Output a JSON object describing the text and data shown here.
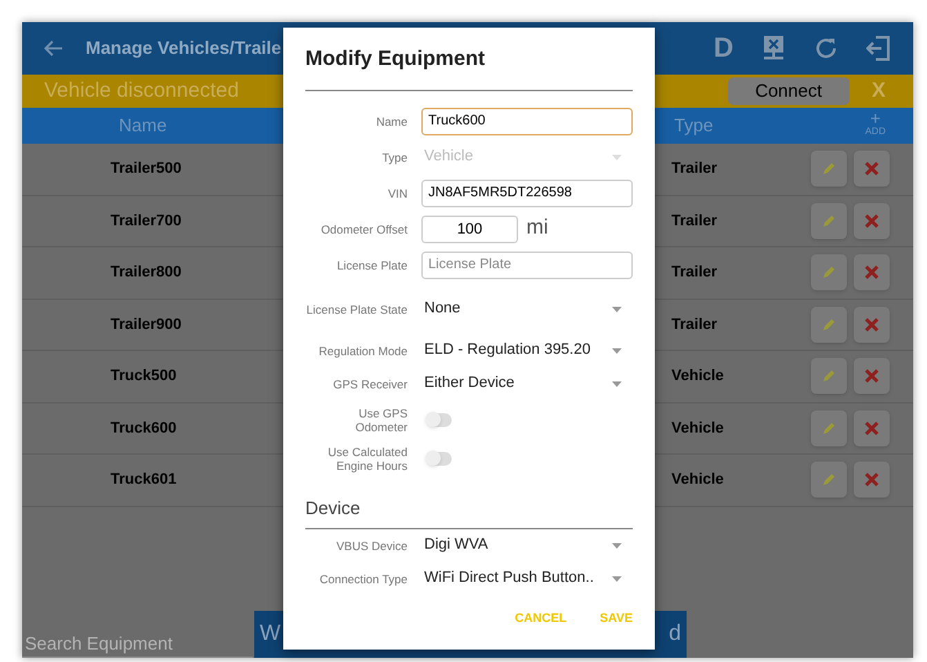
{
  "app_bar": {
    "title": "Manage Vehicles/Traile",
    "actions": [
      "D"
    ]
  },
  "banner": {
    "message": "Vehicle disconnected",
    "connect": "Connect",
    "dismiss": "X"
  },
  "table": {
    "columns": [
      "Name",
      "Type"
    ],
    "add": {
      "icon": "+",
      "label": "ADD"
    },
    "rows": [
      {
        "name": "Trailer500",
        "type": "Trailer"
      },
      {
        "name": "Trailer700",
        "type": "Trailer"
      },
      {
        "name": "Trailer800",
        "type": "Trailer"
      },
      {
        "name": "Trailer900",
        "type": "Trailer"
      },
      {
        "name": "Truck500",
        "type": "Vehicle"
      },
      {
        "name": "Truck600",
        "type": "Vehicle"
      },
      {
        "name": "Truck601",
        "type": "Vehicle"
      }
    ]
  },
  "search": {
    "placeholder": "Search Equipment"
  },
  "bottom_button": {
    "left_part": "W",
    "right_part": "d"
  },
  "dialog": {
    "title": "Modify Equipment",
    "fields": [
      {
        "kind": "input",
        "label": "Name",
        "value": "Truck600",
        "focused": true
      },
      {
        "kind": "select",
        "label": "Type",
        "value": "Vehicle",
        "disabled": true
      },
      {
        "kind": "input",
        "label": "VIN",
        "value": "JN8AF5MR5DT226598",
        "focused": false
      },
      {
        "kind": "number",
        "label": "Odometer Offset",
        "value": "100",
        "unit": "mi"
      },
      {
        "kind": "input",
        "label": "License Plate",
        "placeholder": "License Plate",
        "focused": false
      },
      {
        "kind": "select",
        "label": "License Plate State",
        "value": "None",
        "disabled": false
      },
      {
        "kind": "select",
        "label": "Regulation Mode",
        "value": "ELD - Regulation 395.20",
        "disabled": false
      },
      {
        "kind": "select",
        "label": "GPS Receiver",
        "value": "Either Device",
        "disabled": false
      },
      {
        "kind": "switch",
        "label": "Use GPS Odometer",
        "on": false
      },
      {
        "kind": "switch",
        "label": "Use Calculated Engine Hours",
        "on": false
      },
      {
        "kind": "section",
        "label": "Device"
      },
      {
        "kind": "select",
        "label": "VBUS Device",
        "value": "Digi WVA",
        "disabled": false
      },
      {
        "kind": "select",
        "label": "Connection Type",
        "value": "WiFi Direct Push Button..",
        "disabled": false
      }
    ],
    "buttons": [
      "CANCEL",
      "SAVE"
    ]
  }
}
